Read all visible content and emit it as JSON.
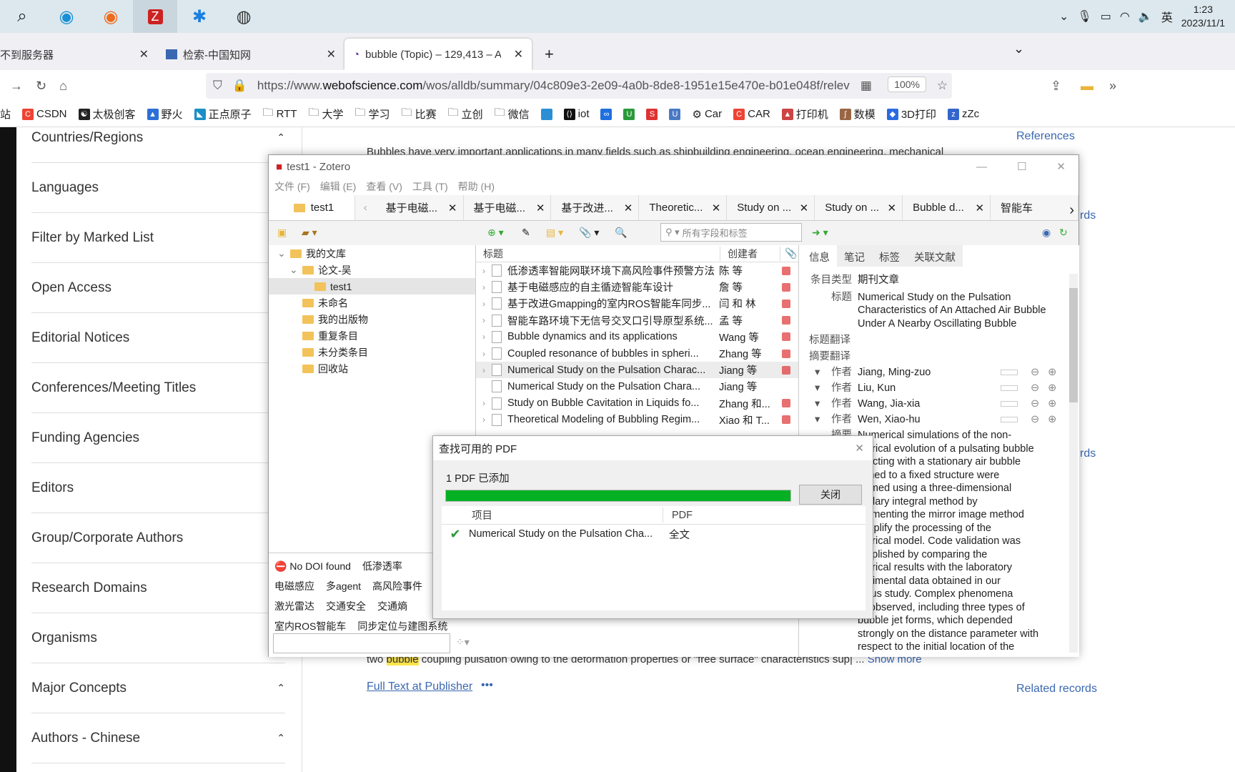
{
  "taskbar": {
    "icons": [
      "search-icon",
      "edge-icon",
      "firefox-icon",
      "zotero-icon",
      "app-star-icon",
      "obs-icon"
    ],
    "ime": "英",
    "time": "1:23",
    "date": "2023/11/1"
  },
  "browser": {
    "tabs": [
      {
        "label": "不到服务器"
      },
      {
        "label": "检索-中国知网"
      },
      {
        "label": "bubble (Topic) – 129,413 – A"
      }
    ],
    "url_prefix": "https://www.",
    "url_host": "webofscience.com",
    "url_rest": "/wos/alldb/summary/04c809e3-2e09-4a0b-8de8-1951e15e470e-b01e048f/relev",
    "zoom": "100%",
    "bookmarks": [
      "站",
      "CSDN",
      "太极创客",
      "野火",
      "正点原子",
      "RTT",
      "大学",
      "学习",
      "比赛",
      "立创",
      "微信",
      "",
      "iot",
      "",
      "",
      "",
      "",
      "Car",
      "CAR",
      "打印机",
      "数模",
      "3D打印",
      "zZc"
    ]
  },
  "wos": {
    "filters": [
      "Countries/Regions",
      "Languages",
      "Filter by Marked List",
      "Open Access",
      "Editorial Notices",
      "Conferences/Meeting Titles",
      "Funding Agencies",
      "Editors",
      "Group/Corporate Authors",
      "Research Domains",
      "Organisms",
      "Major Concepts",
      "Authors - Chinese"
    ],
    "abstract_top": "Bubbles have very important applications in many fields such as shipbuilding engineering, ocean engineering, mechanical",
    "abstract_bottom_pre": "two ",
    "abstract_highlight": "bubble",
    "abstract_bottom_post": " coupling pulsation owing to the deformation properties or \"free surface\" characteristics sup| ...",
    "show_more": "Show more",
    "full_text": "Full Text at Publisher",
    "more": "•••",
    "references": "References",
    "related": "Related records",
    "rds": "rds"
  },
  "zotero": {
    "title": "test1 - Zotero",
    "menu": [
      "文件 (F)",
      "编辑 (E)",
      "查看 (V)",
      "工具 (T)",
      "帮助 (H)"
    ],
    "library_tab": "test1",
    "tabs": [
      "基于电磁...",
      "基于电磁...",
      "基于改进...",
      "Theoretic...",
      "Study on ...",
      "Study on ...",
      "Bubble d...",
      "智能车"
    ],
    "search_placeholder": "所有字段和标签",
    "collections": [
      {
        "label": "我的文库",
        "level": 0
      },
      {
        "label": "论文-吴",
        "level": 1
      },
      {
        "label": "test1",
        "level": 2,
        "selected": true
      },
      {
        "label": "未命名",
        "level": 1
      },
      {
        "label": "我的出版物",
        "level": 1
      },
      {
        "label": "重复条目",
        "level": 1
      },
      {
        "label": "未分类条目",
        "level": 1
      },
      {
        "label": "回收站",
        "level": 1
      }
    ],
    "tags": [
      [
        "No DOI found",
        "低渗透率"
      ],
      [
        "电磁感应",
        "多agent",
        "高风险事件"
      ],
      [
        "激光雷达",
        "交通安全",
        "交通熵"
      ],
      [
        "室内ROS智能车",
        "同步定位与建图系统"
      ]
    ],
    "columns": {
      "title": "标题",
      "creator": "创建者"
    },
    "items": [
      {
        "title": "低渗透率智能网联环境下高风险事件预警方法",
        "creator": "陈 等",
        "pdf": true
      },
      {
        "title": "基于电磁感应的自主循迹智能车设计",
        "creator": "詹 等",
        "pdf": true
      },
      {
        "title": "基于改进Gmapping的室内ROS智能车同步...",
        "creator": "闫 和 林",
        "pdf": true
      },
      {
        "title": "智能车路环境下无信号交叉口引导原型系统...",
        "creator": "孟 等",
        "pdf": true
      },
      {
        "title": "Bubble dynamics and its applications",
        "creator": "Wang 等",
        "pdf": true
      },
      {
        "title": "Coupled resonance of bubbles in spheri...",
        "creator": "Zhang 等",
        "pdf": true
      },
      {
        "title": "Numerical Study on the Pulsation Charac...",
        "creator": "Jiang 等",
        "pdf": true,
        "selected": true
      },
      {
        "title": "Numerical Study on the Pulsation Chara...",
        "creator": "Jiang 等",
        "pdf": false
      },
      {
        "title": "Study on Bubble Cavitation in Liquids fo...",
        "creator": "Zhang 和...",
        "pdf": true
      },
      {
        "title": "Theoretical Modeling of Bubbling Regim...",
        "creator": "Xiao 和 T...",
        "pdf": true
      }
    ],
    "info_tabs": [
      "信息",
      "笔记",
      "标签",
      "关联文献"
    ],
    "fields": {
      "type_label": "条目类型",
      "type": "期刊文章",
      "title_label": "标题",
      "title": "Numerical Study on the Pulsation Characteristics of An Attached Air Bubble Under A Nearby Oscillating Bubble",
      "title_tr": "标题翻译",
      "abs_tr": "摘要翻译",
      "author_label": "作者",
      "authors": [
        "Jiang, Ming-zuo",
        "Liu, Kun",
        "Wang, Jia-xia",
        "Wen, Xiao-hu"
      ],
      "abstract_label": "摘要",
      "abstract_lines": [
        "Numerical simulations of the non-",
        "merical evolution of a pulsating bubble",
        "eracting with a stationary air bubble",
        "ached to a fixed structure were",
        "formed using a three-dimensional",
        "undary integral method by",
        "plementing the mirror image method",
        "simplify the processing of the",
        "merical model. Code validation was",
        "omplished by comparing the",
        "merical results with the laboratory",
        "perimental data obtained in our",
        "vious study. Complex phenomena",
        "re observed, including three types of",
        "bubble jet forms, which depended",
        "strongly on the distance parameter with",
        "respect to the initial location of the"
      ]
    }
  },
  "dialog": {
    "title": "查找可用的 PDF",
    "status": "1 PDF 已添加",
    "progress_percent": 100,
    "close": "关闭",
    "col_item": "项目",
    "col_pdf": "PDF",
    "row_item": "Numerical Study on the Pulsation Cha...",
    "row_pdf": "全文"
  },
  "colors": {
    "progress": "#06b025",
    "accent": "#3a67b1"
  }
}
